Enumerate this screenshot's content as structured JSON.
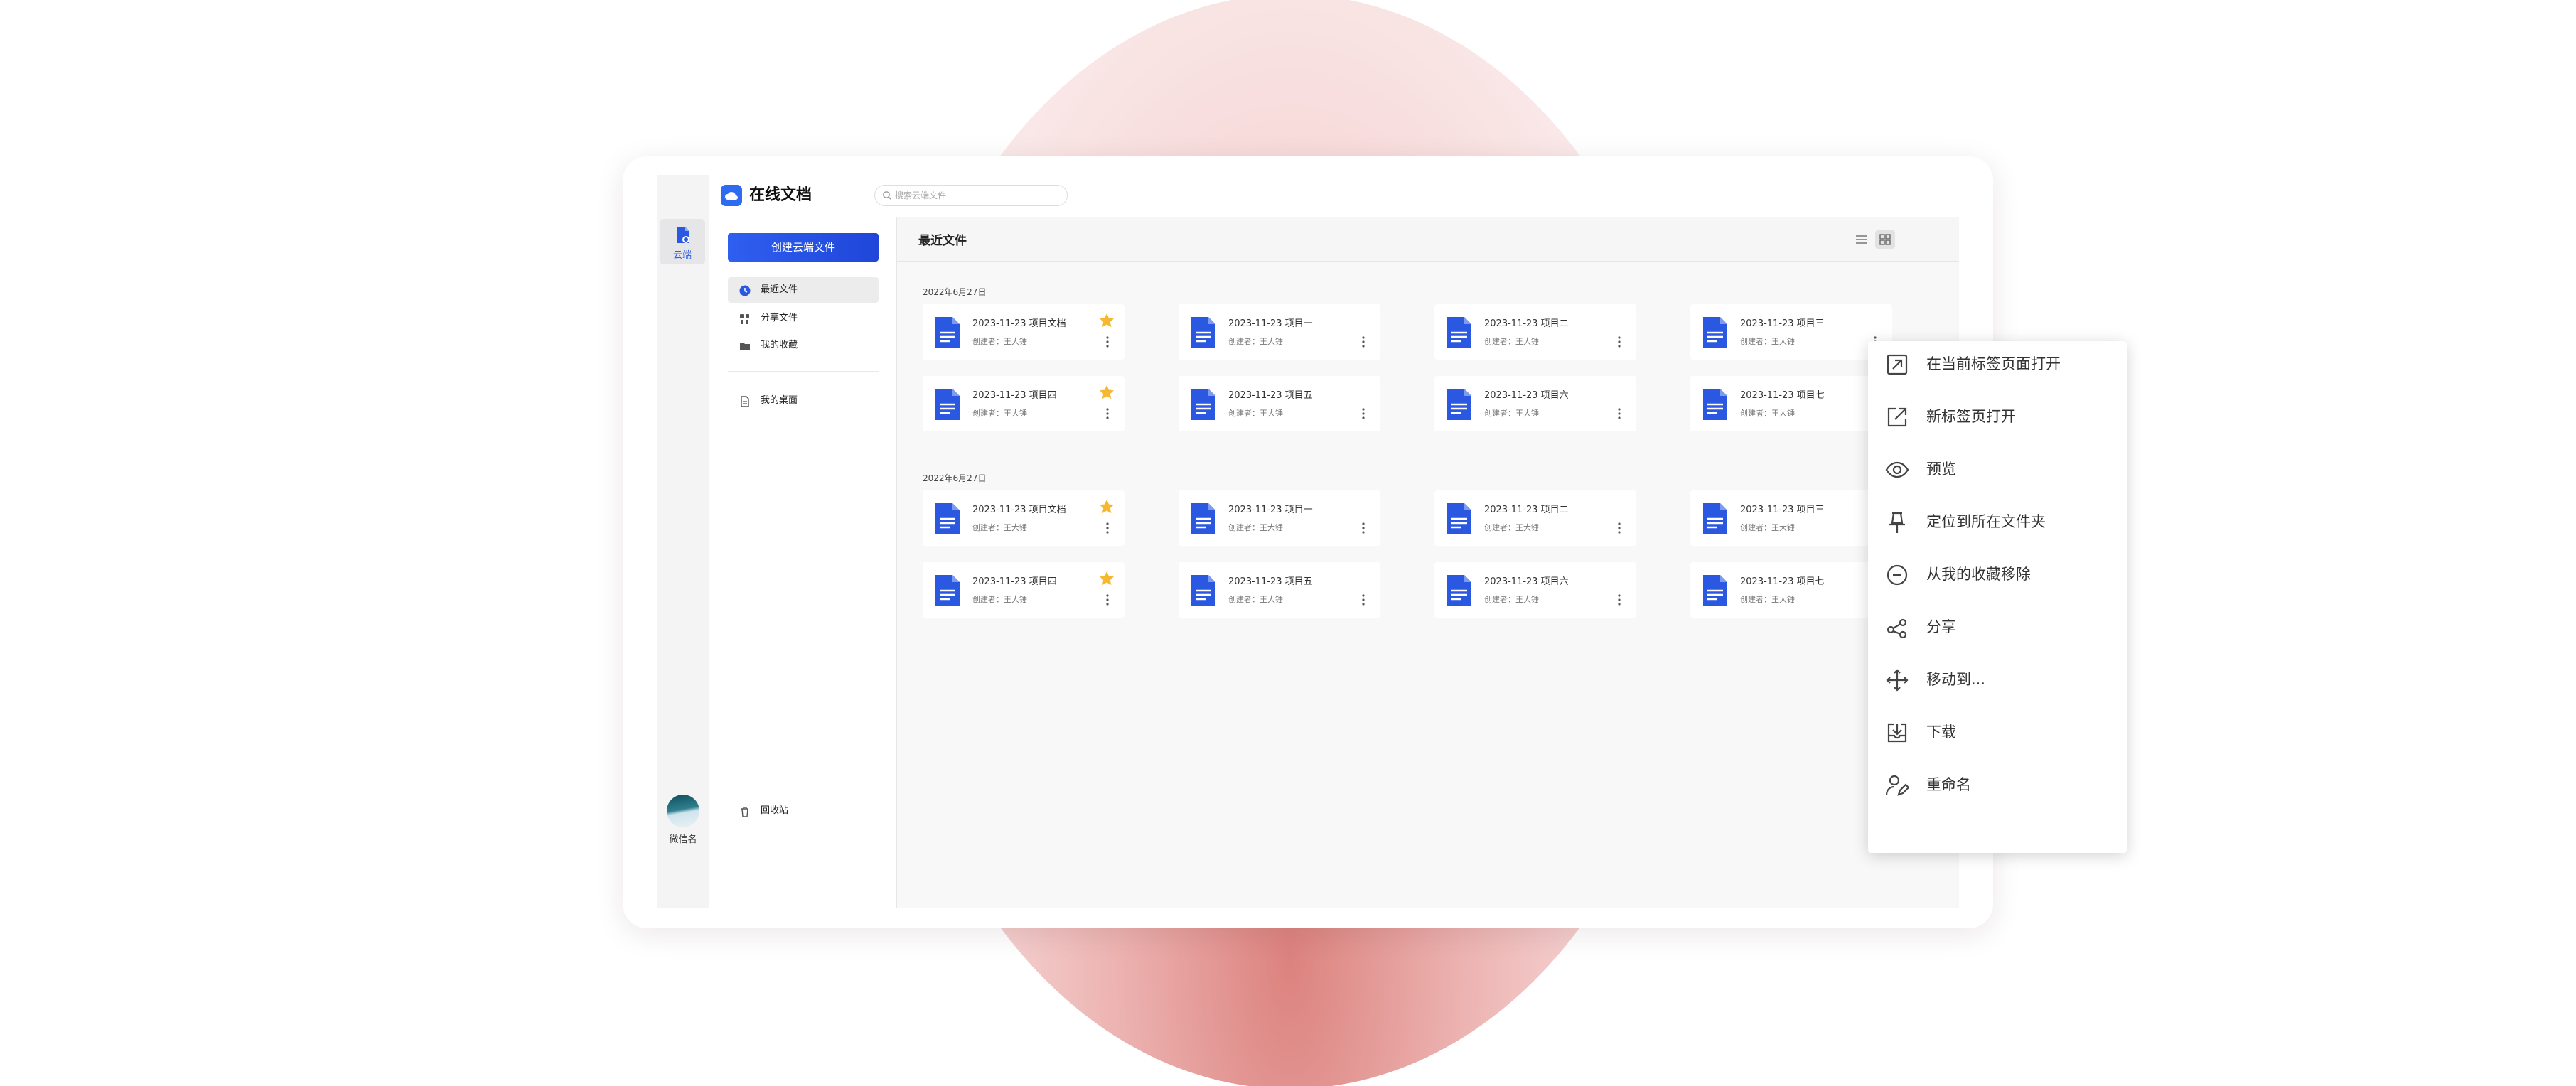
{
  "app": {
    "title": "在线文档"
  },
  "rail": {
    "nav_label": "云端",
    "user_name": "微信名"
  },
  "search": {
    "placeholder": "搜索云端文件"
  },
  "sidebar": {
    "create_label": "创建云端文件",
    "items": [
      {
        "label": "最近文件",
        "icon": "clock-icon"
      },
      {
        "label": "分享文件",
        "icon": "people-icon"
      },
      {
        "label": "我的收藏",
        "icon": "folder-icon"
      },
      {
        "label": "我的桌面",
        "icon": "desktop-doc-icon"
      }
    ],
    "trash_label": "回收站"
  },
  "main": {
    "title": "最近文件",
    "groups": [
      {
        "date": "2022年6月27日",
        "files": [
          {
            "name": "2023-11-23  项目文档",
            "owner": "创建者：王大锤",
            "starred": true
          },
          {
            "name": "2023-11-23  项目一",
            "owner": "创建者：王大锤",
            "starred": false
          },
          {
            "name": "2023-11-23  项目二",
            "owner": "创建者：王大锤",
            "starred": false
          },
          {
            "name": "2023-11-23  项目三",
            "owner": "创建者：王大锤",
            "starred": false
          },
          {
            "name": "2023-11-23  项目四",
            "owner": "创建者：王大锤",
            "starred": true
          },
          {
            "name": "2023-11-23  项目五",
            "owner": "创建者：王大锤",
            "starred": false
          },
          {
            "name": "2023-11-23  项目六",
            "owner": "创建者：王大锤",
            "starred": false
          },
          {
            "name": "2023-11-23  项目七",
            "owner": "创建者：王大锤",
            "starred": false
          }
        ]
      },
      {
        "date": "2022年6月27日",
        "files": [
          {
            "name": "2023-11-23  项目文档",
            "owner": "创建者：王大锤",
            "starred": true
          },
          {
            "name": "2023-11-23  项目一",
            "owner": "创建者：王大锤",
            "starred": false
          },
          {
            "name": "2023-11-23  项目二",
            "owner": "创建者：王大锤",
            "starred": false
          },
          {
            "name": "2023-11-23  项目三",
            "owner": "创建者：王大锤",
            "starred": false
          },
          {
            "name": "2023-11-23  项目四",
            "owner": "创建者：王大锤",
            "starred": true
          },
          {
            "name": "2023-11-23  项目五",
            "owner": "创建者：王大锤",
            "starred": false
          },
          {
            "name": "2023-11-23  项目六",
            "owner": "创建者：王大锤",
            "starred": false
          },
          {
            "name": "2023-11-23  项目七",
            "owner": "创建者：王大锤",
            "starred": false
          }
        ]
      }
    ]
  },
  "context_menu": {
    "items": [
      {
        "label": "在当前标签页面打开",
        "icon": "open-arrow-icon"
      },
      {
        "label": "新标签页打开",
        "icon": "new-tab-icon"
      },
      {
        "label": "预览",
        "icon": "eye-icon"
      },
      {
        "label": "定位到所在文件夹",
        "icon": "pin-icon"
      },
      {
        "label": "从我的收藏移除",
        "icon": "minus-circle-icon"
      },
      {
        "label": "分享",
        "icon": "share-icon"
      },
      {
        "label": "移动到...",
        "icon": "move-icon"
      },
      {
        "label": "下载",
        "icon": "download-icon"
      },
      {
        "label": "重命名",
        "icon": "rename-icon"
      }
    ]
  },
  "colors": {
    "accent": "#2d6cf0",
    "doc_icon": "#2b58e0",
    "star": "#f5b82e"
  }
}
